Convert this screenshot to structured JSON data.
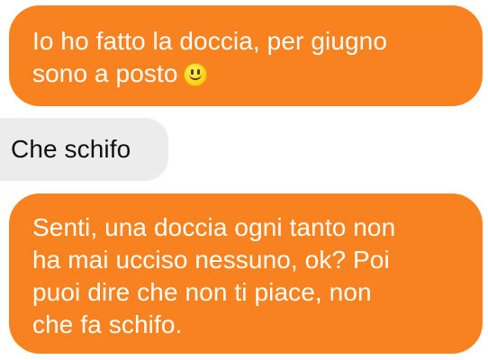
{
  "messages": [
    {
      "direction": "sent",
      "lines": [
        "Io ho fatto la doccia, per giugno",
        "sono a posto"
      ],
      "trailing_icon": "smiley-face-icon"
    },
    {
      "direction": "received",
      "lines": [
        "Che schifo"
      ]
    },
    {
      "direction": "sent",
      "lines": [
        "Senti, una doccia ogni tanto non",
        "ha mai ucciso nessuno, ok? Poi",
        "puoi dire che non ti piace, non",
        "che fa schifo."
      ]
    }
  ],
  "colors": {
    "sent_bubble": "#f7821f",
    "sent_text": "#ffffff",
    "received_bubble": "#ececec",
    "received_text": "#111111",
    "background": "#ffffff"
  }
}
